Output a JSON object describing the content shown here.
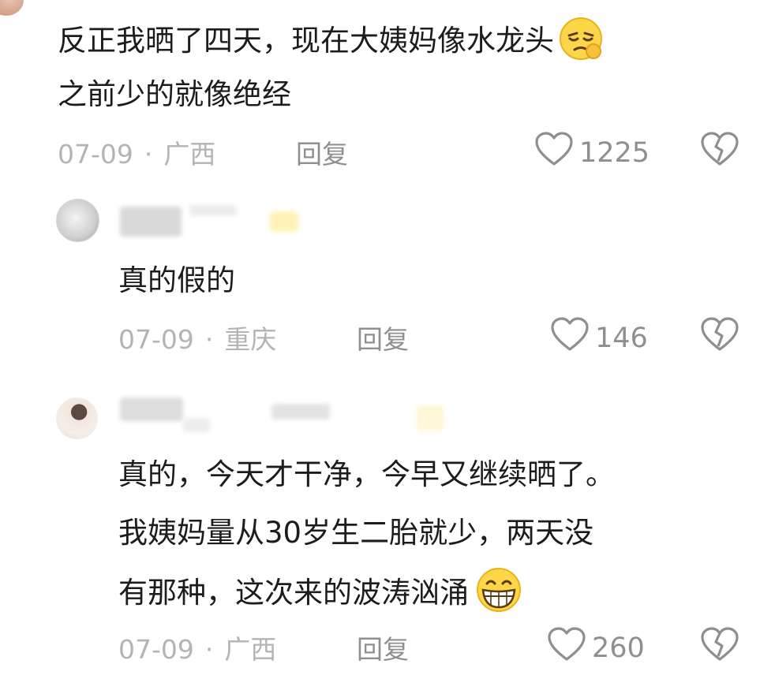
{
  "comments": [
    {
      "text_lines": [
        "反正我晒了四天，现在大姨妈像水龙头",
        "之前少的就像绝经"
      ],
      "date": "07-09",
      "location": "广西",
      "reply_label": "回复",
      "likes": "1225",
      "emoji": "pensive-face-icon"
    },
    {
      "text_lines": [
        "真的假的"
      ],
      "date": "07-09",
      "location": "重庆",
      "reply_label": "回复",
      "likes": "146"
    },
    {
      "text_lines": [
        "真的，今天才干净，今早又继续晒了。",
        "我姨妈量从30岁生二胎就少，两天没",
        "有那种，这次来的波涛汹涌"
      ],
      "date": "07-09",
      "location": "广西",
      "reply_label": "回复",
      "likes": "260",
      "emoji": "grinning-face-icon"
    }
  ],
  "separator": "·",
  "colors": {
    "meta": "#b4b4b4",
    "icon": "#8f8f8f",
    "text": "#1c1c1c"
  }
}
